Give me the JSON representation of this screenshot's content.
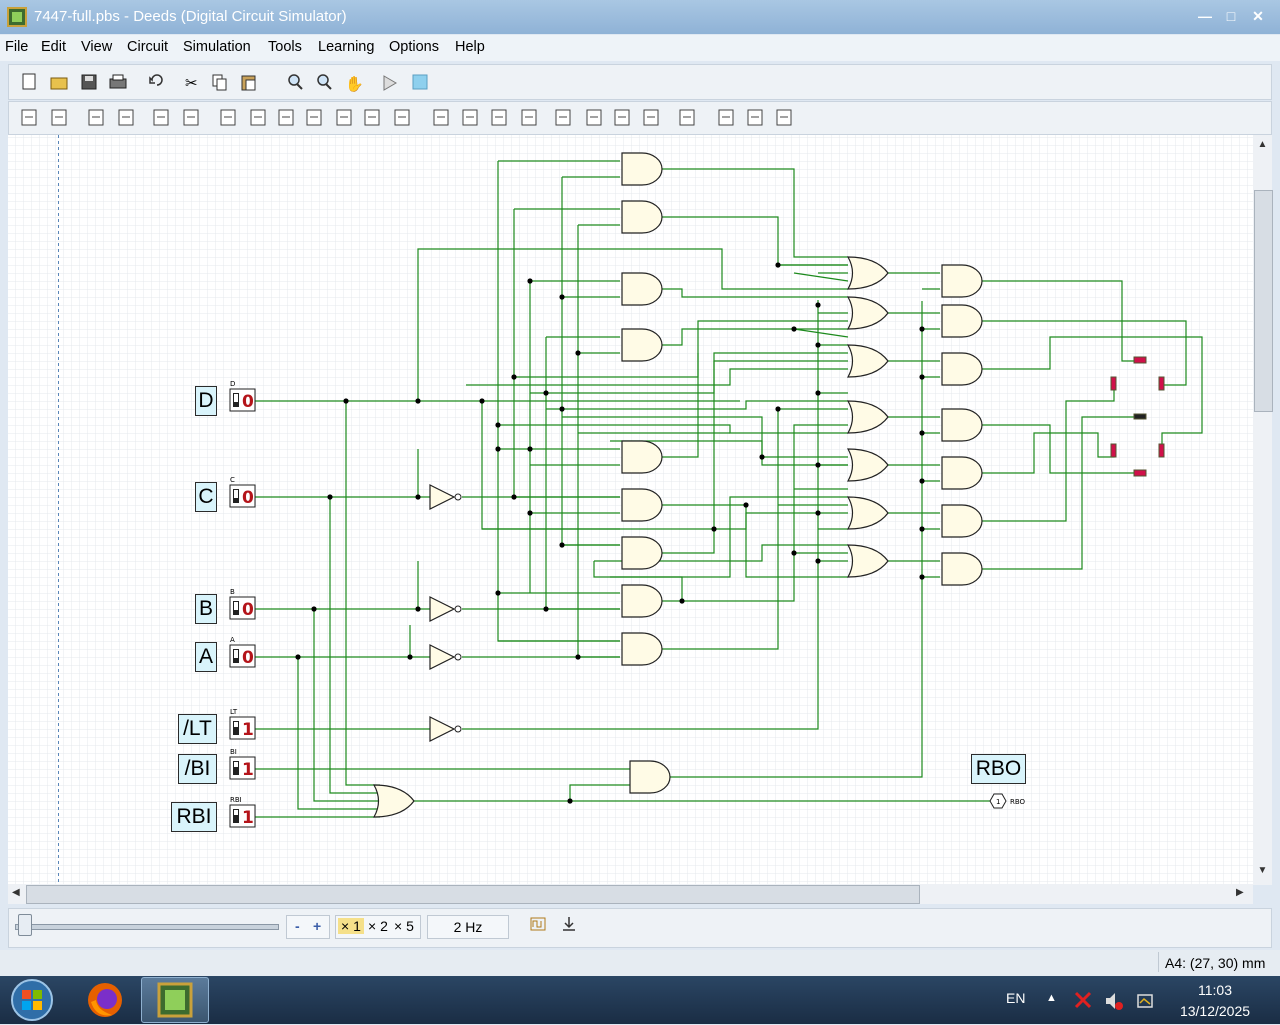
{
  "window": {
    "title": "7447-full.pbs - Deeds (Digital Circuit Simulator)"
  },
  "menu": [
    "File",
    "Edit",
    "View",
    "Circuit",
    "Simulation",
    "Tools",
    "Learning",
    "Options",
    "Help"
  ],
  "toolbar1": [
    "new-icon",
    "open-icon",
    "save-icon",
    "print-icon",
    "undo-icon",
    "cut-icon",
    "copy-icon",
    "paste-icon",
    "zoom-in-icon",
    "zoom-out-icon",
    "hand-icon",
    "simulation-icon",
    "timing-icon"
  ],
  "circuit": {
    "inputs": [
      {
        "label": "D",
        "small": "D",
        "value": "0"
      },
      {
        "label": "C",
        "small": "C",
        "value": "0"
      },
      {
        "label": "B",
        "small": "B",
        "value": "0"
      },
      {
        "label": "A",
        "small": "A",
        "value": "0"
      },
      {
        "label": "/LT",
        "small": "LT",
        "value": "1"
      },
      {
        "label": "/BI",
        "small": "BI",
        "value": "1"
      },
      {
        "label": "RBI",
        "small": "RBI",
        "value": "1"
      }
    ],
    "rbo_label": "RBO",
    "rbo_small": "RBO",
    "rbo_value": "1"
  },
  "bottom": {
    "minus": "-",
    "plus": "+",
    "x1": "× 1",
    "x2": "× 2",
    "x5": "× 5",
    "freq": "2 Hz"
  },
  "status": {
    "coords": "A4: (27, 30) mm"
  },
  "taskbar": {
    "lang": "EN",
    "time": "11:03",
    "date": "13/12/2025"
  },
  "colors": {
    "wire": "#1d8a1d",
    "gate_fill": "#fffbe6",
    "seg": "#d0104a",
    "label_bg": "#d9f4fb"
  }
}
